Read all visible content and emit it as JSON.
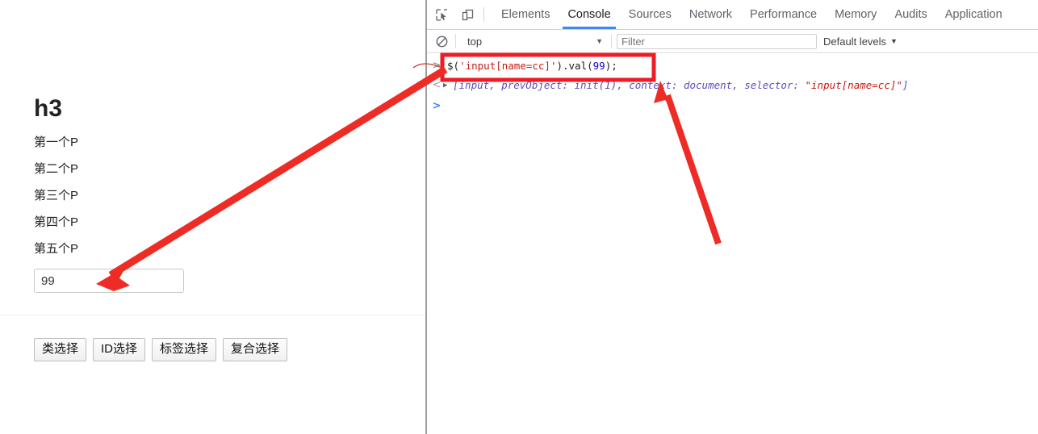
{
  "page": {
    "heading": "h3",
    "paragraphs": [
      "第一个P",
      "第二个P",
      "第三个P",
      "第四个P",
      "第五个P"
    ],
    "input": {
      "value": "99",
      "placeholder": ""
    },
    "buttons": [
      "类选择",
      "ID选择",
      "标签选择",
      "复合选择"
    ]
  },
  "devtools": {
    "icons": {
      "inspect": "inspect-element-icon",
      "device": "device-toolbar-icon",
      "clear": "clear-console-icon"
    },
    "tabs": [
      {
        "label": "Elements",
        "active": false
      },
      {
        "label": "Console",
        "active": true
      },
      {
        "label": "Sources",
        "active": false
      },
      {
        "label": "Network",
        "active": false
      },
      {
        "label": "Performance",
        "active": false
      },
      {
        "label": "Memory",
        "active": false
      },
      {
        "label": "Audits",
        "active": false
      },
      {
        "label": "Application",
        "active": false
      }
    ],
    "toolbar": {
      "context": "top",
      "context_caret": "▼",
      "filter_placeholder": "Filter",
      "filter_value": "",
      "levels": "Default levels",
      "levels_caret": "▼"
    },
    "console": {
      "input_marker": ">",
      "output_marker": "<",
      "prompt_marker": ">",
      "expander": "▶",
      "command": {
        "full": "$('input[name=cc]').val(99);",
        "tokens": [
          {
            "t": "$(",
            "c": "plain"
          },
          {
            "t": "'input[name=cc]'",
            "c": "string"
          },
          {
            "t": ").val(",
            "c": "plain"
          },
          {
            "t": "99",
            "c": "number"
          },
          {
            "t": ");",
            "c": "plain"
          }
        ]
      },
      "output": {
        "full": "[input, prevObject: init(1), context: document, selector: \"input[name=cc]\"]",
        "tokens": [
          {
            "t": "[input, prevObject: init(1), context: document, selector: ",
            "c": "obj"
          },
          {
            "t": "\"input[name=cc]\"",
            "c": "str"
          },
          {
            "t": "]",
            "c": "obj"
          }
        ]
      }
    }
  },
  "annotations": {
    "highlight_color": "#ee1c25",
    "arrow_color": "#ee2b25",
    "box_label": "highlighted-console-command",
    "arrow_to_input": "arrow-pointing-to-input-field",
    "arrow_to_output": "arrow-pointing-to-console-output"
  }
}
